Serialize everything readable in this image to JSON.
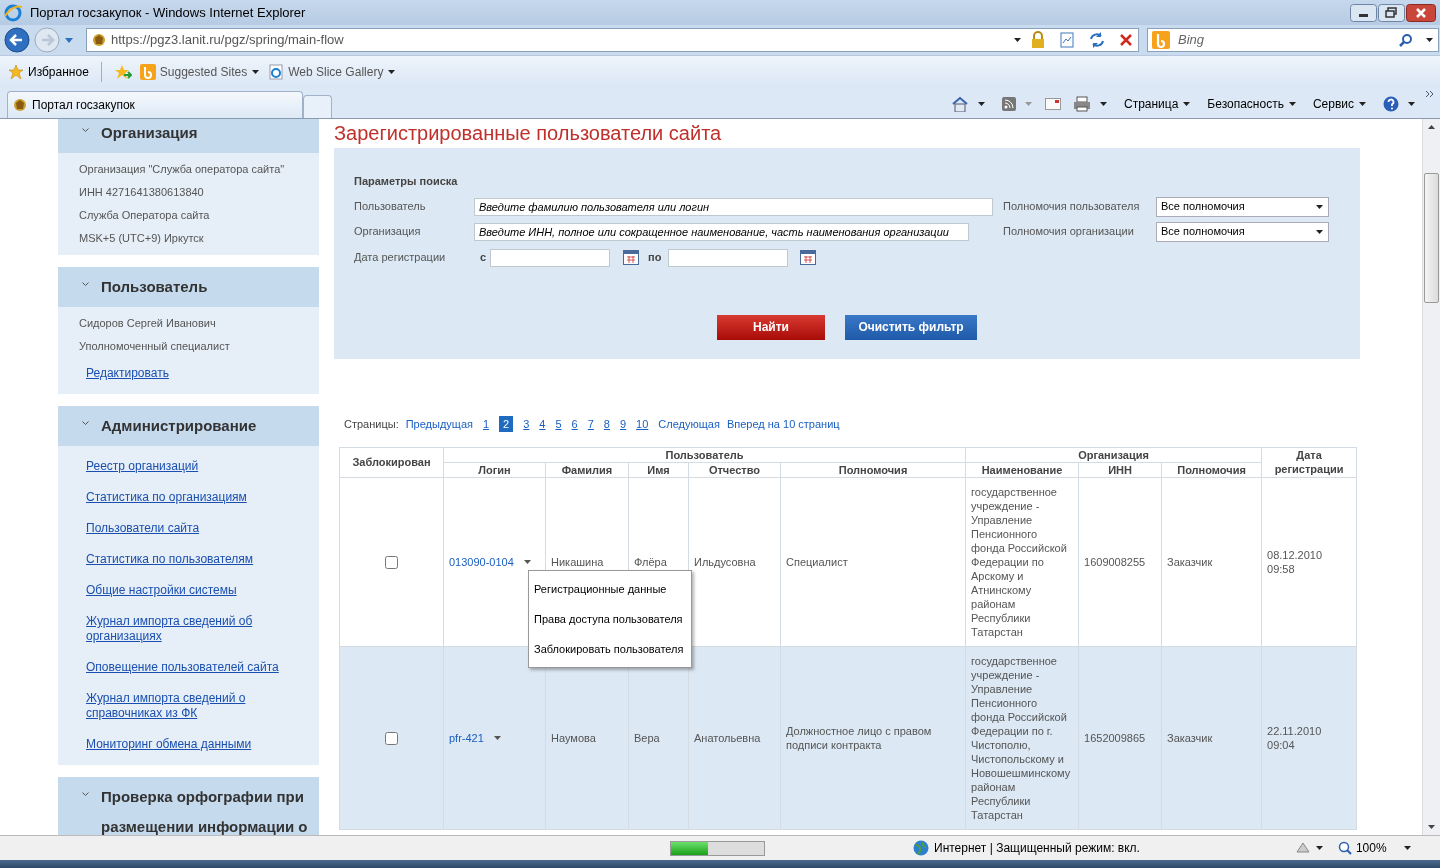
{
  "window": {
    "title": "Портал госзакупок - Windows Internet Explorer"
  },
  "address_bar": {
    "url": "https://pgz3.lanit.ru/pgz/spring/main-flow",
    "search_placeholder": "Bing"
  },
  "favorites_bar": {
    "favorites": "Избранное",
    "links": [
      "Suggested Sites",
      "Web Slice Gallery"
    ]
  },
  "tab": {
    "title": "Портал госзакупок"
  },
  "command_bar": [
    "Страница",
    "Безопасность",
    "Сервис"
  ],
  "sidebar": [
    {
      "title": "Организация",
      "items": [
        {
          "kind": "text",
          "label": "Организация \"Служба оператора сайта\""
        },
        {
          "kind": "text",
          "label": "ИНН 4271641380613840"
        },
        {
          "kind": "text",
          "label": "Служба Оператора сайта"
        },
        {
          "kind": "text",
          "label": "MSK+5 (UTC+9) Иркутск"
        }
      ]
    },
    {
      "title": "Пользователь",
      "items": [
        {
          "kind": "text",
          "label": "Сидоров Сергей Иванович"
        },
        {
          "kind": "text",
          "label": "Уполномоченный специалист"
        },
        {
          "kind": "link",
          "label": "Редактировать"
        }
      ]
    },
    {
      "title": "Администрирование",
      "items": [
        {
          "kind": "link",
          "label": "Реестр организаций"
        },
        {
          "kind": "link",
          "label": "Статистика по организациям"
        },
        {
          "kind": "link",
          "label": "Пользователи сайта"
        },
        {
          "kind": "link",
          "label": "Статистика по пользователям"
        },
        {
          "kind": "link",
          "label": "Общие настройки системы"
        },
        {
          "kind": "link",
          "label": "Журнал импорта сведений об организациях"
        },
        {
          "kind": "link",
          "label": "Оповещение пользователей сайта"
        },
        {
          "kind": "link",
          "label": "Журнал импорта сведений о справочниках из ФК"
        },
        {
          "kind": "link",
          "label": "Мониторинг обмена данными"
        }
      ]
    },
    {
      "title": "Проверка орфографии при размещении информации о"
    }
  ],
  "page_title": "Зарегистрированные пользователи сайта",
  "search_panel": {
    "heading": "Параметры поиска",
    "user": {
      "label": "Пользователь",
      "placeholder": "Введите фамилию пользователя или логин"
    },
    "organization": {
      "label": "Организация",
      "placeholder": "Введите ИНН, полное или сокращенное наименование, часть наименования организации"
    },
    "user_rights": {
      "label": "Полномочия пользователя",
      "value": "Все полномочия"
    },
    "org_rights": {
      "label": "Полномочия организации",
      "value": "Все полномочия"
    },
    "date": {
      "label": "Дата регистрации",
      "from": "с",
      "to": "по"
    },
    "buttons": [
      "Найти",
      "Очистить фильтр"
    ]
  },
  "pagination": {
    "label": "Страницы:",
    "prev": "Предыдущая",
    "pages": [
      {
        "label": "1",
        "selected": false
      },
      {
        "label": "2",
        "selected": true
      },
      {
        "label": "3",
        "selected": false
      },
      {
        "label": "4",
        "selected": false
      },
      {
        "label": "5",
        "selected": false
      },
      {
        "label": "6",
        "selected": false
      },
      {
        "label": "7",
        "selected": false
      },
      {
        "label": "8",
        "selected": false
      },
      {
        "label": "9",
        "selected": false
      },
      {
        "label": "10",
        "selected": false
      }
    ],
    "next": "Следующая",
    "forward": "Вперед на 10 страниц"
  },
  "table": {
    "group_headers": [
      "Заблокирован",
      "Пользователь",
      "Организация",
      "Дата регистрации"
    ],
    "columns": [
      "Логин",
      "Фамилия",
      "Имя",
      "Отчество",
      "Полномочия",
      "Наименование",
      "ИНН",
      "Полномочия"
    ],
    "rows": [
      {
        "checked": false,
        "login": "013090-0104",
        "last_name": "Никашина",
        "first_name": "Флёра",
        "patronymic": "Ильдусовна",
        "rights": "Специалист",
        "org_name": "государственное учреждение - Управление Пенсионного фонда Российской Федерации по Арскому и Атнинскому районам Республики Татарстан",
        "inn": "1609008255",
        "org_rights": "Заказчик",
        "date": "08.12.2010 09:58"
      },
      {
        "checked": false,
        "login": "pfr-421",
        "last_name": "Наумова",
        "first_name": "Вера",
        "patronymic": "Анатольевна",
        "rights": "Должностное лицо с правом подписи контракта",
        "org_name": "государственное учреждение - Управление Пенсионного фонда Российской Федерации по г. Чистополю, Чистопольскому и Новошешминскому районам Республики Татарстан",
        "inn": "1652009865",
        "org_rights": "Заказчик",
        "date": "22.11.2010 09:04"
      }
    ]
  },
  "context_menu": [
    "Регистрационные данные",
    "Права доступа пользователя",
    "Заблокировать пользователя"
  ],
  "status_bar": {
    "progress": {
      "level": 0.4
    },
    "zone": "Интернет | Защищенный режим: вкл.",
    "zoom": "100%"
  }
}
